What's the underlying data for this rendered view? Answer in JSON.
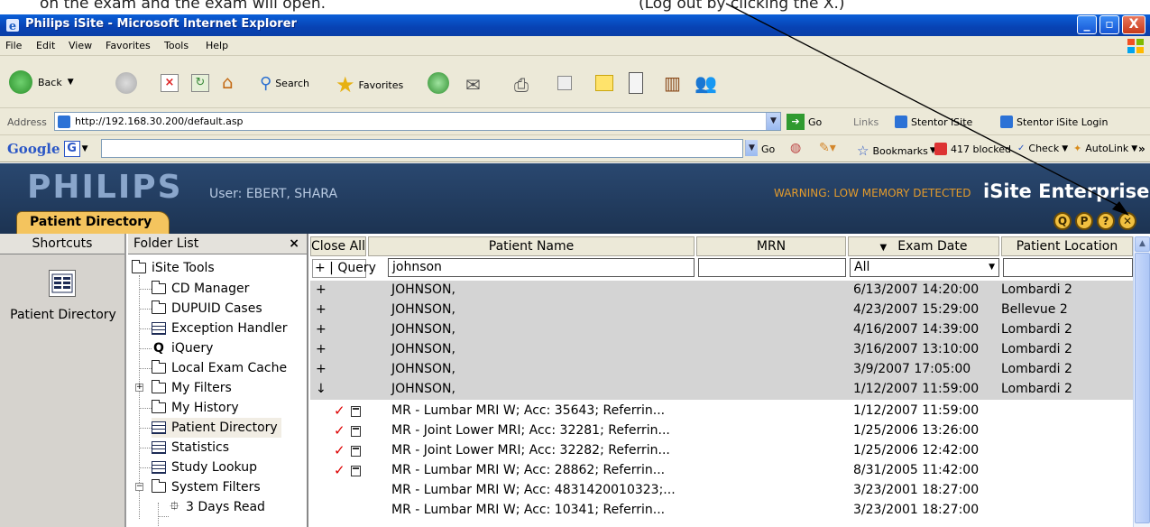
{
  "caption": {
    "left_text": "on the exam and the exam will open.",
    "right_text": "(Log out by clicking the X.)"
  },
  "window": {
    "title": "Philips iSite - Microsoft Internet Explorer",
    "buttons": [
      "_",
      "▫",
      "X"
    ]
  },
  "menu": [
    "File",
    "Edit",
    "View",
    "Favorites",
    "Tools",
    "Help"
  ],
  "toolbar": {
    "back": "Back",
    "search": "Search",
    "favorites": "Favorites"
  },
  "address": {
    "label": "Address",
    "url": "http://192.168.30.200/default.asp",
    "go": "Go",
    "links_label": "Links",
    "link1": "Stentor iSite",
    "link2": "Stentor iSite Login"
  },
  "google": {
    "brand": "Google",
    "go": "Go",
    "bookmarks": "Bookmarks",
    "blocked": "417 blocked",
    "check": "Check",
    "autolink": "AutoLink",
    "more": "»",
    "settings": "Settings"
  },
  "isite": {
    "logo": "PHILIPS",
    "user": "User: EBERT, SHARA",
    "warning": "WARNING: LOW MEMORY DETECTED",
    "brand": "iSite Enterprise",
    "tab": "Patient Directory",
    "header_icons": [
      "Q",
      "P",
      "?",
      "✕"
    ]
  },
  "shortcuts": {
    "header": "Shortcuts",
    "item": "Patient Directory"
  },
  "folders": {
    "header": "Folder List",
    "close": "×",
    "root": "iSite Tools",
    "items": [
      "CD Manager",
      "DUPUID Cases",
      "Exception Handler",
      "iQuery",
      "Local Exam Cache",
      "My Filters",
      "My History",
      "Patient Directory",
      "Statistics",
      "Study Lookup",
      "System Filters",
      "3 Days Read"
    ]
  },
  "grid": {
    "close_all": "Close All",
    "query": "+ | Query",
    "columns": [
      "Patient Name",
      "MRN",
      "Exam Date",
      "Patient Location"
    ],
    "sort_indicator": "▼",
    "filter_name": "johnson",
    "filter_date": "All",
    "patients": [
      {
        "toggle": "+",
        "name": "JOHNSON,",
        "date": "6/13/2007 14:20:00",
        "location": "Lombardi 2"
      },
      {
        "toggle": "+",
        "name": "JOHNSON,",
        "date": "4/23/2007 15:29:00",
        "location": "Bellevue 2"
      },
      {
        "toggle": "+",
        "name": "JOHNSON,",
        "date": "4/16/2007 14:39:00",
        "location": "Lombardi 2"
      },
      {
        "toggle": "+",
        "name": "JOHNSON,",
        "date": "3/16/2007 13:10:00",
        "location": "Lombardi 2"
      },
      {
        "toggle": "+",
        "name": "JOHNSON,",
        "date": "3/9/2007 17:05:00",
        "location": "Lombardi 2"
      },
      {
        "toggle": "↓",
        "name": "JOHNSON,",
        "date": "1/12/2007 11:59:00",
        "location": "Lombardi 2"
      }
    ],
    "exams": [
      {
        "checked": true,
        "desc": "MR - Lumbar MRI W; Acc: 35643;  Referrin...",
        "date": "1/12/2007 11:59:00"
      },
      {
        "checked": true,
        "desc": "MR - Joint Lower MRI; Acc: 32281;  Referrin...",
        "date": "1/25/2006 13:26:00"
      },
      {
        "checked": true,
        "desc": "MR - Joint Lower MRI; Acc: 32282;  Referrin...",
        "date": "1/25/2006 12:42:00"
      },
      {
        "checked": true,
        "desc": "MR - Lumbar MRI W; Acc: 28862;  Referrin...",
        "date": "8/31/2005 11:42:00"
      },
      {
        "checked": false,
        "desc": "MR - Lumbar MRI W; Acc: 4831420010323;...",
        "date": "3/23/2001 18:27:00"
      },
      {
        "checked": false,
        "desc": "MR - Lumbar MRI W; Acc: 10341;  Referrin...",
        "date": "3/23/2001 18:27:00"
      }
    ]
  },
  "colors": {
    "title_bar": "#0842b3",
    "isite_header": "#1c3352",
    "tab": "#f4c45e",
    "warning": "#e39b2c",
    "check": "#dd0000"
  }
}
